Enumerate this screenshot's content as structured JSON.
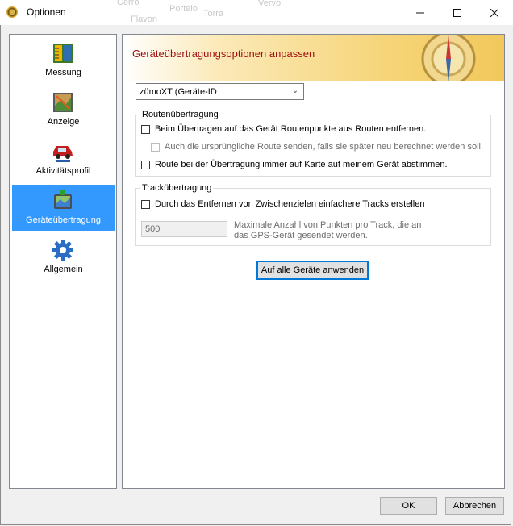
{
  "window": {
    "title": "Optionen"
  },
  "background_map_labels": [
    "Cerro",
    "Portelo",
    "Torra",
    "Flavon",
    "Vervo"
  ],
  "sidebar": {
    "items": [
      {
        "label": "Messung",
        "icon": "ruler-icon"
      },
      {
        "label": "Anzeige",
        "icon": "map-display-icon"
      },
      {
        "label": "Aktivitätsprofil",
        "icon": "car-icon"
      },
      {
        "label": "Geräteübertragung",
        "icon": "device-transfer-icon",
        "selected": true
      },
      {
        "label": "Allgemein",
        "icon": "gear-icon"
      }
    ]
  },
  "panel": {
    "title": "Geräteübertragungsoptionen anpassen",
    "device_select": {
      "value": "zümoXT (Geräte-ID"
    },
    "route_group": {
      "legend": "Routenübertragung",
      "option1": "Beim Übertragen auf das Gerät Routenpunkte aus Routen entfernen.",
      "option1_sub": "Auch die ursprüngliche Route senden, falls sie später neu berechnet werden soll.",
      "option2": "Route bei der Übertragung immer auf Karte auf meinem Gerät abstimmen."
    },
    "track_group": {
      "legend": "Trackübertragung",
      "option1": "Durch das Entfernen von Zwischenzielen einfachere Tracks erstellen",
      "max_points_value": "500",
      "max_points_line1": "Maximale Anzahl von Punkten pro Track, die an",
      "max_points_line2": "das GPS-Gerät gesendet werden."
    },
    "apply_all_label": "Auf alle Geräte anwenden"
  },
  "footer": {
    "ok_label": "OK",
    "cancel_label": "Abbrechen"
  },
  "colors": {
    "selection": "#3399ff",
    "banner_title": "#a01010",
    "focus_border": "#0078d7"
  }
}
